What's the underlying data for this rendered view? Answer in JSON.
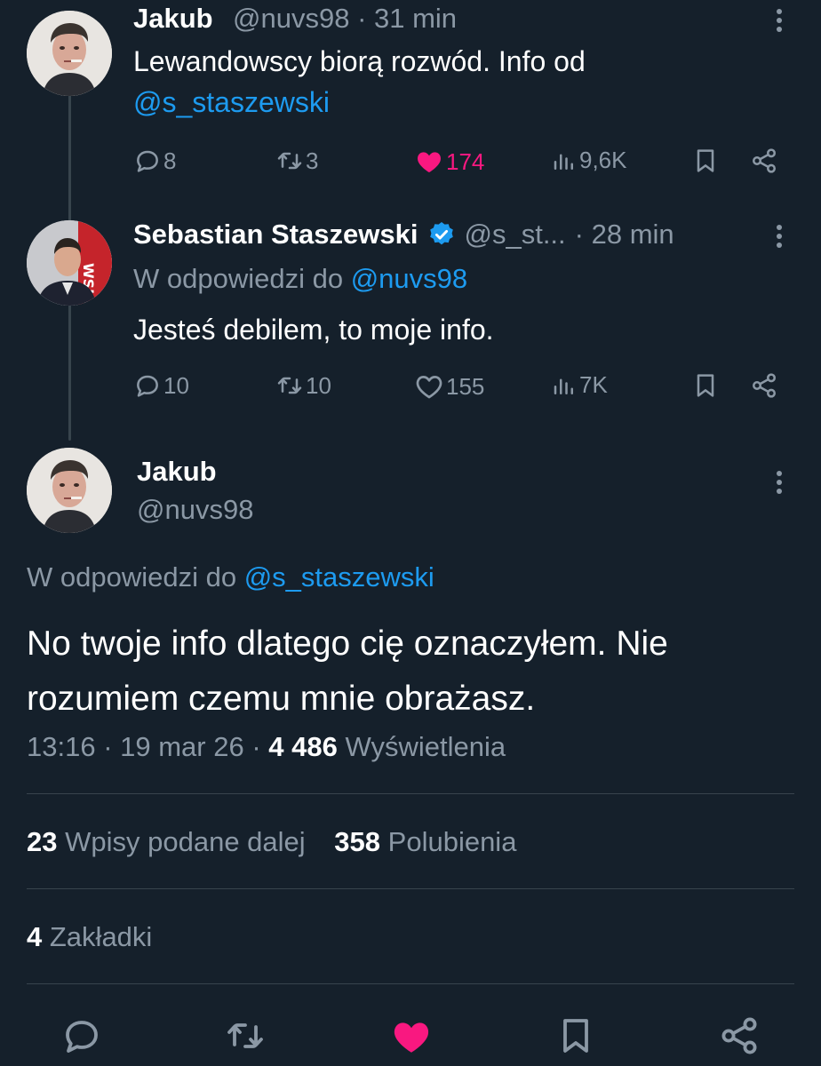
{
  "tweet1": {
    "name": "Jakub",
    "handle": "@nuvs98",
    "time": "· 31 min",
    "text_1": "Lewandowscy biorą rozwód. Info od",
    "mention": "@s_staszewski",
    "replies": "8",
    "retweets": "3",
    "likes": "174",
    "views": "9,6K"
  },
  "tweet2": {
    "name": "Sebastian Staszewski",
    "handle": "@s_st...",
    "time": "· 28 min",
    "reply_prefix": "W odpowiedzi do",
    "reply_to": "@nuvs98",
    "text": "Jesteś debilem, to moje info.",
    "replies": "10",
    "retweets": "10",
    "likes": "155",
    "views": "7K"
  },
  "tweet3": {
    "name": "Jakub",
    "handle": "@nuvs98",
    "reply_prefix": "W odpowiedzi do",
    "reply_to": "@s_staszewski",
    "text_line1": "No twoje info dlatego cię oznaczyłem. Nie",
    "text_line2": "rozumiem czemu mnie obrażasz.",
    "timestamp": "13:16 · 19 mar 26 ·",
    "views_count": "4 486",
    "views_label": "Wyświetlenia",
    "retweets_count": "23",
    "retweets_label": "Wpisy podane dalej",
    "likes_count": "358",
    "likes_label": "Polubienia",
    "bookmarks_count": "4",
    "bookmarks_label": "Zakładki"
  },
  "colors": {
    "background": "#15202b",
    "muted": "#8b98a5",
    "link": "#1d9bf0",
    "like": "#f91880",
    "verified": "#1d9bf0"
  },
  "icons": [
    "reply-icon",
    "retweet-icon",
    "like-icon",
    "views-icon",
    "bookmark-icon",
    "share-icon",
    "more-icon",
    "verified-icon"
  ]
}
